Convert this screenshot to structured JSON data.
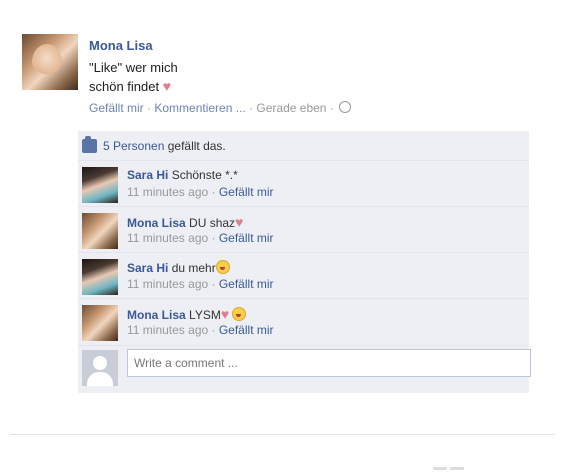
{
  "post": {
    "author": "Mona Lisa",
    "message_line1": "\"Like\" wer mich",
    "message_line2": "schön findet",
    "heart": "♥",
    "action_like": "Gefällt mir",
    "action_comment": "Kommentieren ...",
    "sep": " · ",
    "time": "Gerade eben"
  },
  "likes": {
    "count_text": "5 Personen",
    "suffix": " gefällt das."
  },
  "comments": [
    {
      "author": "Sara Hi",
      "text": "Schönste *.*",
      "time": "11 minutes ago",
      "like": "Gefällt mir"
    },
    {
      "author": "Mona Lisa",
      "text": "DU shaz",
      "time": "11 minutes ago",
      "like": "Gefällt mir"
    },
    {
      "author": "Sara Hi",
      "text": "du mehr",
      "time": "11 minutes ago",
      "like": "Gefällt mir"
    },
    {
      "author": "Mona Lisa",
      "text": "LYSM",
      "time": "11 minutes ago",
      "like": "Gefällt mir"
    }
  ],
  "composer": {
    "placeholder": "Write a comment ..."
  },
  "colors": {
    "link": "#3b5998",
    "panel": "#edeff4",
    "heart": "#e07f8f"
  }
}
